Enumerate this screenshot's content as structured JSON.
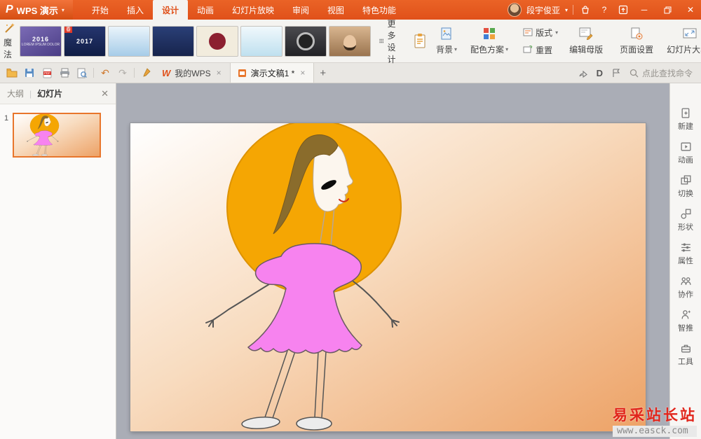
{
  "colors": {
    "titlebar": "#e0511a",
    "accent": "#e8762c",
    "sun_orange": "#f5a603",
    "dress_pink": "#f783ef",
    "watermark_red": "#e1251b",
    "canvas_gray": "#aaadb6"
  },
  "titlebar": {
    "logo_text": "WPS 演示",
    "tabs": [
      "开始",
      "插入",
      "设计",
      "动画",
      "幻灯片放映",
      "审阅",
      "视图",
      "特色功能"
    ],
    "active_tab": "设计",
    "user_name": "段宇俊亚"
  },
  "glyphs": {
    "logo_p": "P",
    "caret": "▾",
    "divider": "|",
    "question": "?",
    "min": "─",
    "close": "✕",
    "undo": "↶",
    "redo": "↷",
    "plus": "+",
    "close_small": "×",
    "w_logo": "W",
    "docer_d": "D"
  },
  "ribbon": {
    "magic": "魔法",
    "more_designs": "更多设计",
    "background": "背景",
    "color_scheme": "配色方案",
    "layout": "版式",
    "reset": "重置",
    "edit_master": "编辑母版",
    "page_setup": "页面设置",
    "slide_size": "幻灯片大小",
    "templates": [
      {
        "label": "2016",
        "sub": "LOREM IPSUM DOLOR",
        "style": "background:linear-gradient(150deg,#7b6bb5 0%,#4a3d85 100%)"
      },
      {
        "label": "2017",
        "sub": "",
        "badge": "春",
        "style": "background:linear-gradient(180deg,#25356e,#101d45)"
      },
      {
        "label": "",
        "sub": "",
        "style": "background:linear-gradient(180deg,#eaf4fb,#a6cce8)"
      },
      {
        "label": "",
        "sub": "",
        "style": "background:linear-gradient(180deg,#2a3f77,#17244d)"
      },
      {
        "label": "",
        "sub": "",
        "style": "background:#f2ecdd"
      },
      {
        "label": "",
        "sub": "",
        "style": "background:linear-gradient(180deg,#f0f8fc,#bfe0ef)"
      },
      {
        "label": "",
        "sub": "",
        "style": "background:linear-gradient(180deg,#4a4a4e,#222226)"
      },
      {
        "label": "",
        "sub": "",
        "style": "background:linear-gradient(180deg,#d8b58f,#9a744f)"
      }
    ]
  },
  "tabbar": {
    "doc_tabs": [
      {
        "label": "我的WPS"
      },
      {
        "label": "演示文稿1 *"
      }
    ],
    "search_text": "点此查找命令"
  },
  "panel": {
    "outline": "大纲",
    "slides": "幻灯片",
    "slide_number": "1"
  },
  "sidebar": {
    "items": [
      "新建",
      "动画",
      "切换",
      "形状",
      "属性",
      "协作",
      "智推",
      "工具"
    ]
  },
  "watermark": {
    "line1": "易采站长站",
    "line2": "www.easck.com"
  }
}
